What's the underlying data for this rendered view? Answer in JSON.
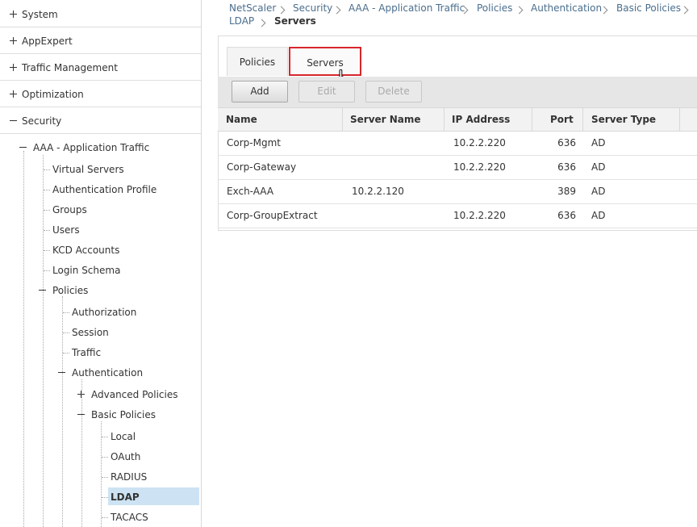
{
  "sidebar": {
    "top_items": [
      {
        "label": "System",
        "state": "collapsed"
      },
      {
        "label": "AppExpert",
        "state": "collapsed"
      },
      {
        "label": "Traffic Management",
        "state": "collapsed"
      },
      {
        "label": "Optimization",
        "state": "collapsed"
      },
      {
        "label": "Security",
        "state": "expanded"
      }
    ],
    "aaa": {
      "label": "AAA - Application Traffic"
    },
    "aaa_children": [
      {
        "label": "Virtual Servers"
      },
      {
        "label": "Authentication Profile"
      },
      {
        "label": "Groups"
      },
      {
        "label": "Users"
      },
      {
        "label": "KCD Accounts"
      },
      {
        "label": "Login Schema"
      }
    ],
    "policies": {
      "label": "Policies"
    },
    "policies_children": [
      {
        "label": "Authorization"
      },
      {
        "label": "Session"
      },
      {
        "label": "Traffic"
      }
    ],
    "authentication": {
      "label": "Authentication"
    },
    "advanced_policies": {
      "label": "Advanced Policies"
    },
    "basic_policies": {
      "label": "Basic Policies"
    },
    "basic_children": [
      {
        "label": "Local"
      },
      {
        "label": "OAuth"
      },
      {
        "label": "RADIUS"
      },
      {
        "label": "LDAP",
        "selected": true
      },
      {
        "label": "TACACS"
      }
    ]
  },
  "breadcrumb": {
    "items": [
      "NetScaler",
      "Security",
      "AAA - Application Traffic",
      "Policies",
      "Authentication",
      "Basic Policies",
      "LDAP"
    ],
    "current": "Servers"
  },
  "tabs": [
    {
      "label": "Policies",
      "active": false
    },
    {
      "label": "Servers",
      "active": true
    }
  ],
  "toolbar": {
    "add_label": "Add",
    "edit_label": "Edit",
    "delete_label": "Delete"
  },
  "table": {
    "columns": [
      "Name",
      "Server Name",
      "IP Address",
      "Port",
      "Server Type"
    ],
    "rows": [
      {
        "name": "Corp-Mgmt",
        "server_name": "",
        "ip": "10.2.2.220",
        "port": "636",
        "type": "AD"
      },
      {
        "name": "Corp-Gateway",
        "server_name": "",
        "ip": "10.2.2.220",
        "port": "636",
        "type": "AD"
      },
      {
        "name": "Exch-AAA",
        "server_name": "10.2.2.120",
        "ip": "",
        "port": "389",
        "type": "AD"
      },
      {
        "name": "Corp-GroupExtract",
        "server_name": "",
        "ip": "10.2.2.220",
        "port": "636",
        "type": "AD"
      }
    ]
  },
  "colors": {
    "highlight_border": "#d7262b",
    "selected_bg": "#cde3f3",
    "link": "#4a6e8d"
  }
}
